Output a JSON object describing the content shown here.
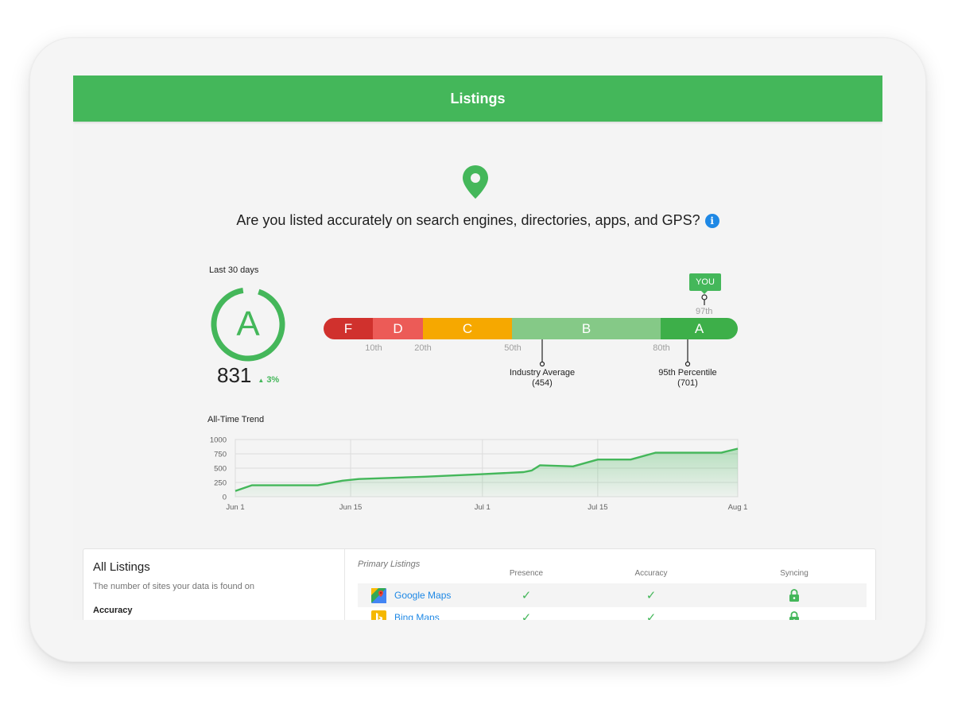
{
  "header": {
    "title": "Listings"
  },
  "hero": {
    "question": "Are you listed accurately on search engines, directories, apps, and GPS?",
    "info_icon": "info-icon",
    "pin_icon": "location-pin-icon"
  },
  "score_card": {
    "period": "Last 30 days",
    "grade": "A",
    "score": "831",
    "delta": "3%",
    "delta_direction": "up"
  },
  "grade_scale": {
    "segments": [
      {
        "label": "F",
        "color": "#d0312d"
      },
      {
        "label": "D",
        "color": "#ec5b57"
      },
      {
        "label": "C",
        "color": "#f6a800"
      },
      {
        "label": "B",
        "color": "#85c987"
      },
      {
        "label": "A",
        "color": "#3daf49"
      }
    ],
    "ticks": [
      "10th",
      "20th",
      "50th",
      "80th"
    ],
    "you_label": "YOU",
    "you_percentile": "97th",
    "industry_average": {
      "label": "Industry Average",
      "value": "(454)"
    },
    "percentile_95": {
      "label": "95th Percentile",
      "value": "(701)"
    }
  },
  "trend": {
    "title": "All-Time Trend",
    "accent": "#44b75a"
  },
  "chart_data": {
    "type": "area",
    "title": "All-Time Trend",
    "xlabel": "",
    "ylabel": "",
    "x_ticks": [
      "Jun 1",
      "Jun 15",
      "Jul 1",
      "Jul 15",
      "Aug 1"
    ],
    "y_ticks": [
      "1000",
      "750",
      "500",
      "250",
      "0"
    ],
    "ylim": [
      0,
      1000
    ],
    "grid": true,
    "x": [
      "Jun 1",
      "Jun 3",
      "Jun 11",
      "Jun 14",
      "Jun 16",
      "Jun 24",
      "Jul 1",
      "Jul 6",
      "Jul 7",
      "Jul 8",
      "Jul 12",
      "Jul 15",
      "Jul 19",
      "Jul 22",
      "Jul 30",
      "Aug 1"
    ],
    "series": [
      {
        "values": [
          100,
          200,
          200,
          280,
          310,
          350,
          395,
          430,
          460,
          550,
          530,
          650,
          650,
          770,
          770,
          840
        ]
      }
    ]
  },
  "listings": {
    "title": "All Listings",
    "subtitle": "The number of sites your data is found on",
    "accuracy_label": "Accuracy",
    "primary_label": "Primary Listings",
    "columns": [
      "Presence",
      "Accuracy",
      "Syncing"
    ],
    "rows": [
      {
        "site": "Google Maps",
        "logo": "google-maps-logo"
      },
      {
        "site": "Bing Maps",
        "logo": "bing-maps-logo"
      }
    ],
    "check_icon": "check-icon",
    "lock_icon": "lock-icon"
  }
}
